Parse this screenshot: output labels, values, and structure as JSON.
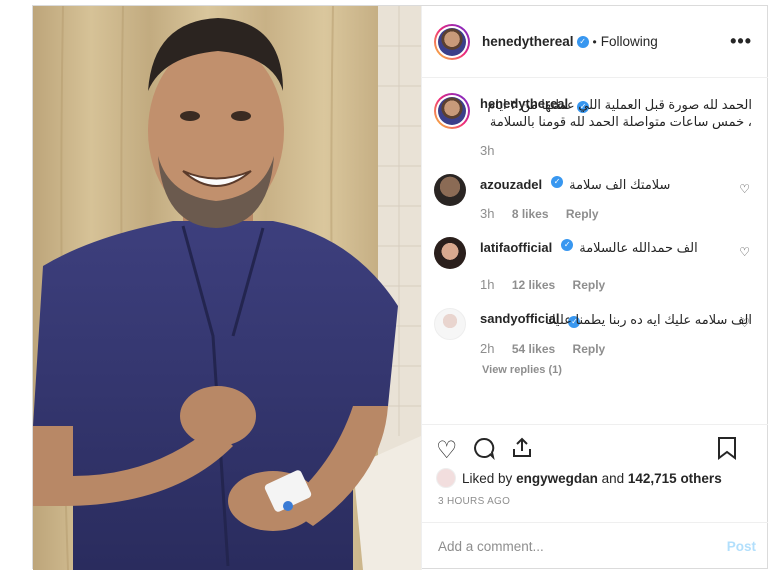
{
  "colors": {
    "verified": "#3897f0",
    "muted": "#8e8e8e",
    "post_disabled": "#b2dffc"
  },
  "header": {
    "username": "henedythereal",
    "separator": "•",
    "follow_state": "Following",
    "more_glyph": "•••"
  },
  "caption": {
    "username": "henedythereal",
    "text": "الحمد لله صورة قبل العملية اللي عملتها من ٣ ايام ، خمس ساعات متواصلة الحمد لله قومنا بالسلامة",
    "time": "3h"
  },
  "comments": [
    {
      "username": "azouzadel",
      "text": "سلامتك الف سلامة",
      "time": "3h",
      "likes": "8 likes",
      "reply": "Reply"
    },
    {
      "username": "latifaofficial",
      "text": "الف حمدالله عالسلامة",
      "time": "1h",
      "likes": "12 likes",
      "reply": "Reply"
    },
    {
      "username": "sandyofficial",
      "text": "الف سلامه عليك ايه ده ربنا يطمنا عليك",
      "time": "2h",
      "likes": "54 likes",
      "reply": "Reply",
      "view_replies": "View replies (1)"
    }
  ],
  "actions": {
    "like_icon": "heart-icon",
    "comment_icon": "comment-icon",
    "share_icon": "share-icon",
    "save_icon": "bookmark-icon"
  },
  "likes": {
    "prefix": "Liked by",
    "user": "engywegdan",
    "connector": "and",
    "count": "142,715 others"
  },
  "posted_ago": "3 HOURS AGO",
  "add_comment": {
    "placeholder": "Add a comment...",
    "post_label": "Post"
  }
}
